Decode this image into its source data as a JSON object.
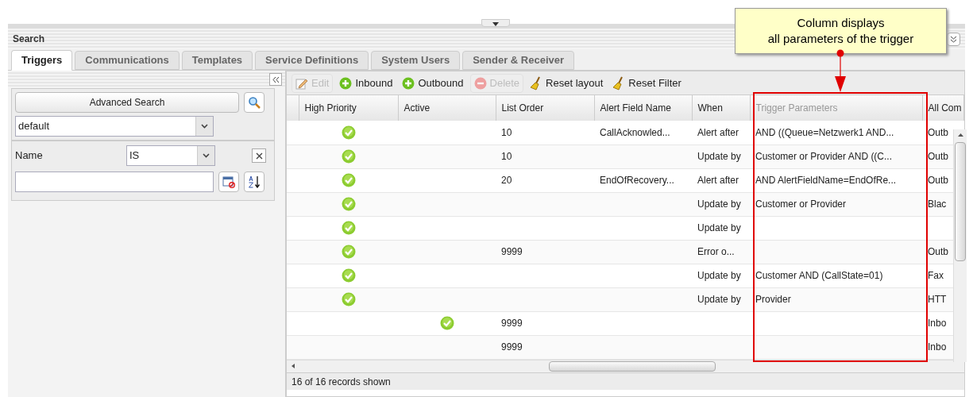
{
  "panel": {
    "title": "Search"
  },
  "tabs": [
    {
      "label": "Triggers",
      "selected": true
    },
    {
      "label": "Communications",
      "selected": false
    },
    {
      "label": "Templates",
      "selected": false
    },
    {
      "label": "Service Definitions",
      "selected": false
    },
    {
      "label": "System Users",
      "selected": false
    },
    {
      "label": "Sender & Receiver",
      "selected": false
    }
  ],
  "search": {
    "button": "Advanced Search",
    "preset": "default",
    "filters": [
      {
        "field": "Name",
        "operator": "IS"
      }
    ]
  },
  "toolbar": [
    {
      "label": "Edit",
      "kind": "edit",
      "disabled": true
    },
    {
      "label": "Inbound",
      "kind": "add",
      "disabled": false
    },
    {
      "label": "Outbound",
      "kind": "add",
      "disabled": false
    },
    {
      "label": "Delete",
      "kind": "delete",
      "disabled": true
    },
    {
      "label": "Reset layout",
      "kind": "reset",
      "disabled": false
    },
    {
      "label": "Reset Filter",
      "kind": "reset",
      "disabled": false
    }
  ],
  "table": {
    "columns": [
      {
        "label": "High Priority",
        "disabled": false
      },
      {
        "label": "Active",
        "disabled": false
      },
      {
        "label": "List Order",
        "disabled": false
      },
      {
        "label": "Alert Field Name",
        "disabled": false
      },
      {
        "label": "When",
        "disabled": false
      },
      {
        "label": "Trigger Parameters",
        "disabled": true
      },
      {
        "label": "All Com",
        "disabled": false
      }
    ],
    "rows": [
      {
        "high_priority": true,
        "active": false,
        "list_order": "10",
        "alert_field_name": "CallAcknowled...",
        "when": "Alert after",
        "trigger_parameters": "AND ((Queue=Netzwerk1 AND...",
        "communications": "Outb"
      },
      {
        "high_priority": true,
        "active": false,
        "list_order": "10",
        "alert_field_name": "",
        "when": "Update by",
        "trigger_parameters": "Customer or Provider AND ((C...",
        "communications": "Outb"
      },
      {
        "high_priority": true,
        "active": false,
        "list_order": "20",
        "alert_field_name": "EndOfRecovery...",
        "when": "Alert after",
        "trigger_parameters": "AND AlertFieldName=EndOfRe...",
        "communications": "Outb"
      },
      {
        "high_priority": true,
        "active": false,
        "list_order": "",
        "alert_field_name": "",
        "when": "Update by",
        "trigger_parameters": "Customer or Provider",
        "communications": "Blac"
      },
      {
        "high_priority": true,
        "active": false,
        "list_order": "",
        "alert_field_name": "",
        "when": "Update by",
        "trigger_parameters": "",
        "communications": ""
      },
      {
        "high_priority": true,
        "active": false,
        "list_order": "9999",
        "alert_field_name": "",
        "when": "Error o...",
        "trigger_parameters": "",
        "communications": "Outb"
      },
      {
        "high_priority": true,
        "active": false,
        "list_order": "",
        "alert_field_name": "",
        "when": "Update by",
        "trigger_parameters": "Customer AND (CallState=01)",
        "communications": "Fax"
      },
      {
        "high_priority": true,
        "active": false,
        "list_order": "",
        "alert_field_name": "",
        "when": "Update by",
        "trigger_parameters": "Provider",
        "communications": "HTT"
      },
      {
        "high_priority": false,
        "active": true,
        "list_order": "9999",
        "alert_field_name": "",
        "when": "",
        "trigger_parameters": "",
        "communications": "Inbo"
      },
      {
        "high_priority": false,
        "active": false,
        "list_order": "9999",
        "alert_field_name": "",
        "when": "",
        "trigger_parameters": "",
        "communications": "Inbo"
      }
    ]
  },
  "status_bar": "16 of 16 records shown",
  "callout": {
    "text_lines": [
      "Column displays",
      "all parameters of the trigger"
    ]
  }
}
